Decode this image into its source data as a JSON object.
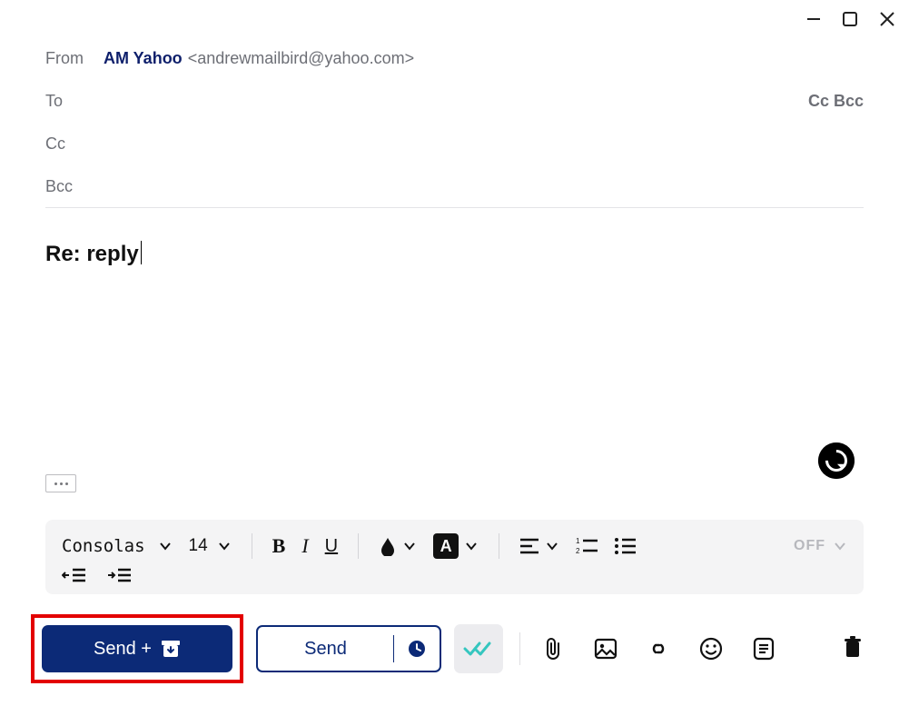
{
  "window": {},
  "from": {
    "label": "From",
    "name": "AM Yahoo",
    "address": "<andrewmailbird@yahoo.com>"
  },
  "recipients": {
    "to_label": "To",
    "cc_label": "Cc",
    "bcc_label": "Bcc",
    "ccbcc_toggle": "Cc Bcc"
  },
  "subject": "Re: reply",
  "format": {
    "font": "Consolas",
    "size": "14",
    "tracking_off": "OFF"
  },
  "actions": {
    "send_archive": "Send  +",
    "send": "Send"
  }
}
